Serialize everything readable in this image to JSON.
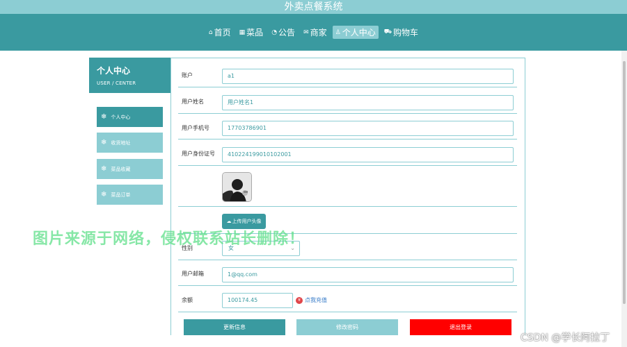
{
  "header": {
    "title": "外卖点餐系统"
  },
  "nav": [
    {
      "icon": "home-icon",
      "glyph": "⌂",
      "label": "首页"
    },
    {
      "icon": "dish-icon",
      "glyph": "▦",
      "label": "菜品"
    },
    {
      "icon": "notice-icon",
      "glyph": "◔",
      "label": "公告"
    },
    {
      "icon": "mail-icon",
      "glyph": "✉",
      "label": "商家"
    },
    {
      "icon": "user-icon",
      "glyph": "♙",
      "label": "个人中心",
      "active": true
    },
    {
      "icon": "cart-icon",
      "glyph": "⛟",
      "label": "购物车"
    }
  ],
  "sidebar": {
    "title": "个人中心",
    "subtitle": "USER / CENTER",
    "items": [
      {
        "label": "个人中心",
        "active": true
      },
      {
        "label": "收货地址"
      },
      {
        "label": "菜品收藏"
      },
      {
        "label": "菜品订单"
      }
    ]
  },
  "form": {
    "account_label": "账户",
    "account_value": "a1",
    "name_label": "用户姓名",
    "name_value": "用户姓名1",
    "phone_label": "用户手机号",
    "phone_value": "17703786901",
    "idcard_label": "用户身份证号",
    "idcard_value": "410224199010102001",
    "upload_label": "上传用户头像",
    "gender_label": "性别",
    "gender_value": "女",
    "email_label": "用户邮箱",
    "email_value": "1@qq.com",
    "balance_label": "余额",
    "balance_value": "100174.45",
    "recharge_label": "点我充值"
  },
  "buttons": {
    "update": "更新信息",
    "change_password": "修改密码",
    "logout": "退出登录"
  },
  "watermark": "图片来源于网络，侵权联系站长删除！",
  "credit": "CSDN @学长阿拉丁",
  "colors": {
    "primary": "#3a9aa0",
    "light": "#8ccdd3",
    "danger": "#ff0000"
  }
}
